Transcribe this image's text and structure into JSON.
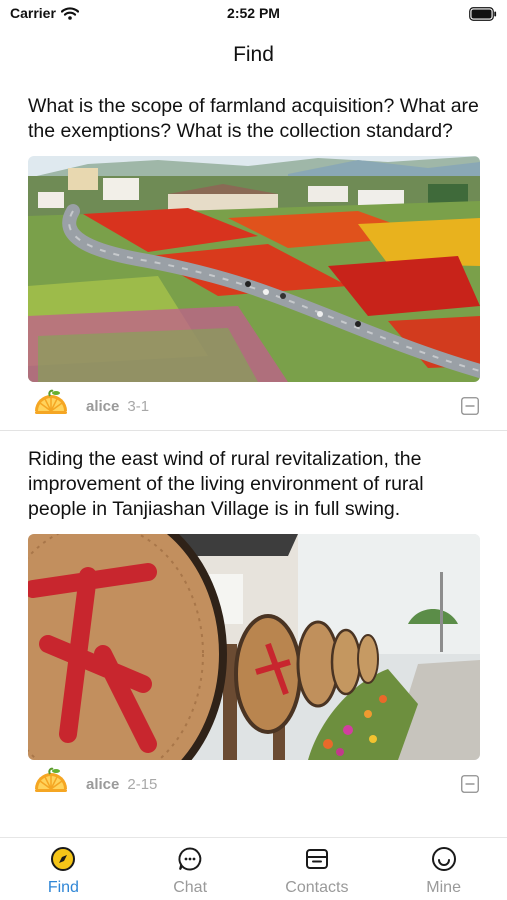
{
  "status_bar": {
    "carrier": "Carrier",
    "time": "2:52 PM"
  },
  "nav": {
    "title": "Find"
  },
  "posts": [
    {
      "title": "What is the scope of farmland acquisition? What are the exemptions? What is the collection standard?",
      "image": "village-flower-fields-photo",
      "author": "alice",
      "date": "3-1"
    },
    {
      "title": "Riding the east wind of rural revitalization, the improvement of the living environment of rural people in Tanjiashan Village is in full swing.",
      "image": "woven-basket-decorations-photo",
      "author": "alice",
      "date": "2-15"
    }
  ],
  "tabs": [
    {
      "label": "Find",
      "icon": "compass-icon",
      "active": true
    },
    {
      "label": "Chat",
      "icon": "chat-bubble-icon",
      "active": false
    },
    {
      "label": "Contacts",
      "icon": "contacts-card-icon",
      "active": false
    },
    {
      "label": "Mine",
      "icon": "smiley-icon",
      "active": false
    }
  ],
  "colors": {
    "accent": "#2f86d6",
    "inactive": "#9a9a9a",
    "avatar_orange": "#f5a623"
  }
}
